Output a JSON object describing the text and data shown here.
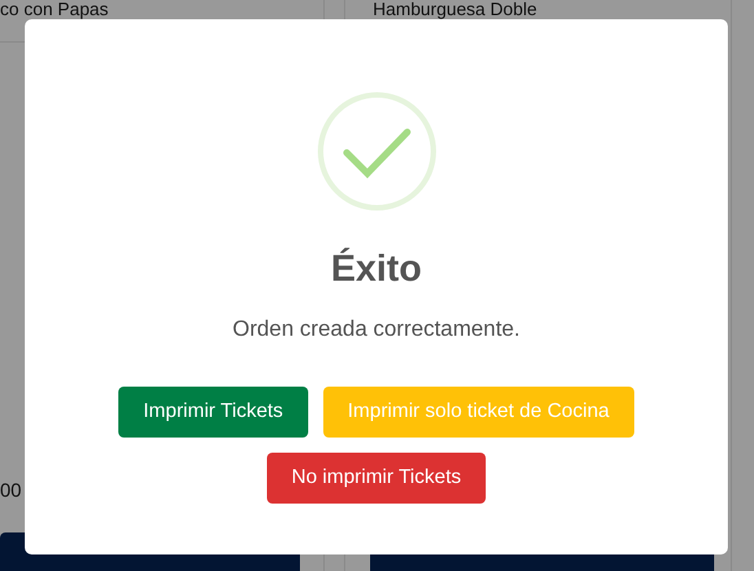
{
  "background_cards": [
    {
      "title": "co con Papas",
      "price": "00"
    },
    {
      "title": "Hamburguesa Doble"
    }
  ],
  "dialog": {
    "kind": "success",
    "title": "Éxito",
    "message": "Orden creada correctamente.",
    "buttons": [
      {
        "label": "Imprimir Tickets",
        "kind": "confirm"
      },
      {
        "label": "Imprimir solo ticket de Cocina",
        "kind": "partial"
      },
      {
        "label": "No imprimir Tickets",
        "kind": "deny"
      }
    ]
  }
}
